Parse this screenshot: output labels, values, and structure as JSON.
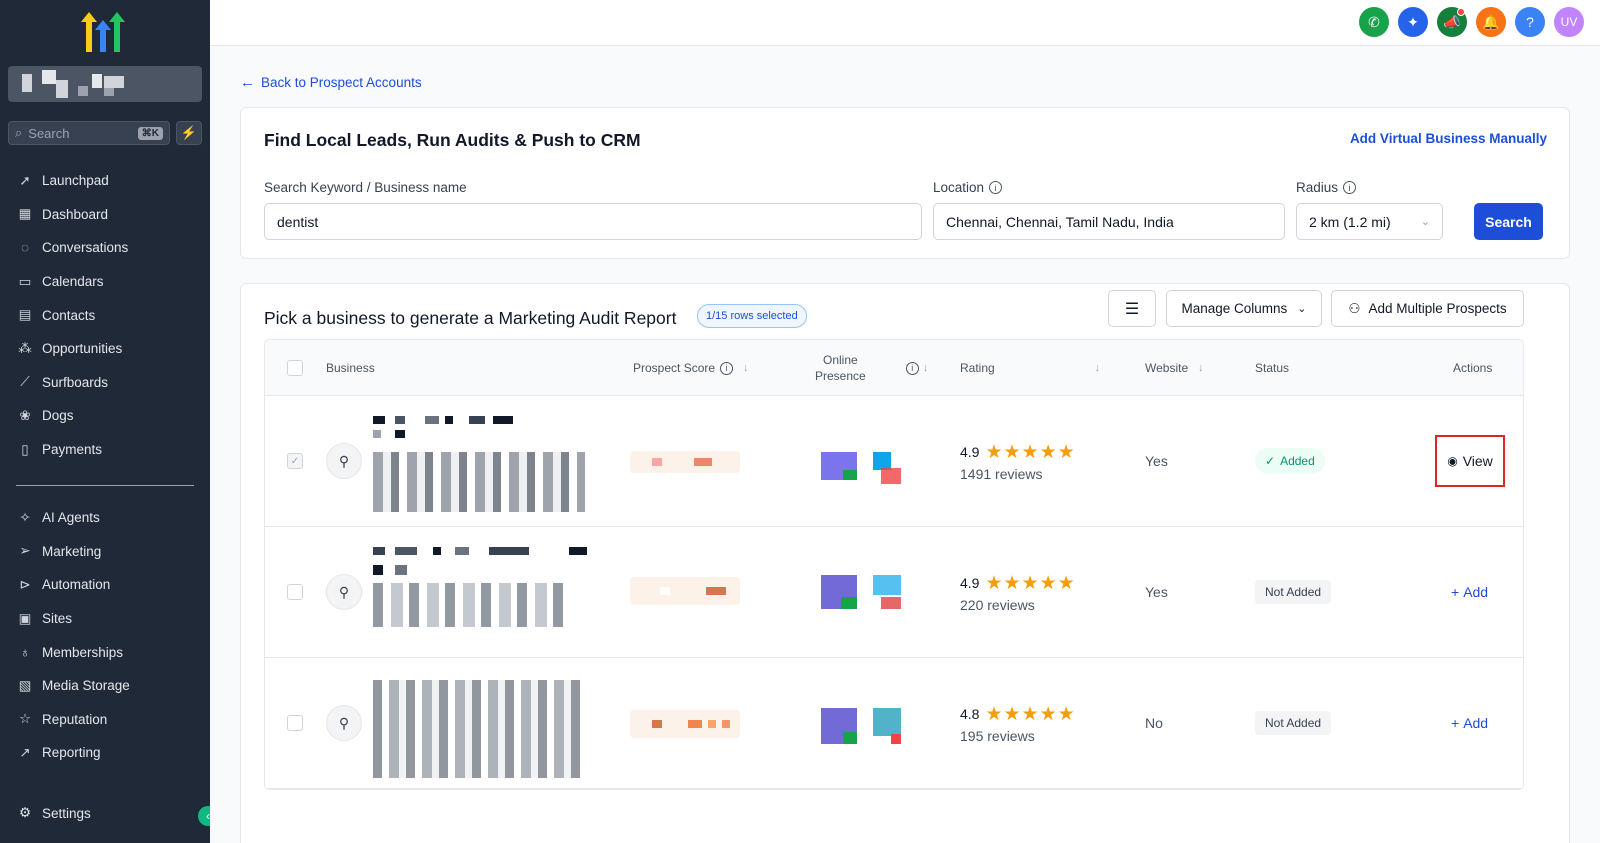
{
  "sidebar": {
    "search_placeholder": "Search",
    "search_shortcut": "⌘K",
    "items": [
      {
        "label": "Launchpad",
        "icon": "rocket-icon"
      },
      {
        "label": "Dashboard",
        "icon": "grid-icon"
      },
      {
        "label": "Conversations",
        "icon": "chat-icon"
      },
      {
        "label": "Calendars",
        "icon": "calendar-icon"
      },
      {
        "label": "Contacts",
        "icon": "contacts-icon"
      },
      {
        "label": "Opportunities",
        "icon": "network-icon"
      },
      {
        "label": "Surfboards",
        "icon": "surfboard-icon"
      },
      {
        "label": "Dogs",
        "icon": "paw-icon"
      },
      {
        "label": "Payments",
        "icon": "receipt-icon"
      }
    ],
    "items2": [
      {
        "label": "AI Agents",
        "icon": "sparkle-icon"
      },
      {
        "label": "Marketing",
        "icon": "send-icon"
      },
      {
        "label": "Automation",
        "icon": "play-circle-icon"
      },
      {
        "label": "Sites",
        "icon": "globe-icon"
      },
      {
        "label": "Memberships",
        "icon": "badge-icon"
      },
      {
        "label": "Media Storage",
        "icon": "image-icon"
      },
      {
        "label": "Reputation",
        "icon": "star-icon"
      },
      {
        "label": "Reporting",
        "icon": "trend-icon"
      }
    ],
    "settings_label": "Settings"
  },
  "topbar": {
    "icons": [
      {
        "name": "phone-icon",
        "color": "#16a34a"
      },
      {
        "name": "ai-sparkle-icon",
        "color": "#2563eb"
      },
      {
        "name": "megaphone-icon",
        "color": "#15803d"
      },
      {
        "name": "bell-icon",
        "color": "#f97316"
      },
      {
        "name": "help-icon",
        "color": "#3b82f6"
      }
    ],
    "avatar_initials": "UV",
    "avatar_color": "#c084fc"
  },
  "back_link": "Back to Prospect Accounts",
  "finder": {
    "title": "Find Local Leads, Run Audits & Push to CRM",
    "add_virtual": "Add Virtual Business Manually",
    "keyword_label": "Search Keyword / Business name",
    "keyword_value": "dentist",
    "location_label": "Location",
    "location_value": "Chennai, Chennai, Tamil Nadu, India",
    "radius_label": "Radius",
    "radius_value": "2 km (1.2 mi)",
    "search_button": "Search"
  },
  "results": {
    "title": "Pick a business to generate a Marketing Audit Report",
    "selected_badge": "1/15 rows selected",
    "manage_columns": "Manage Columns",
    "add_multiple": "Add Multiple Prospects",
    "columns": {
      "business": "Business",
      "prospect_score": "Prospect Score",
      "online_presence_1": "Online",
      "online_presence_2": "Presence",
      "rating": "Rating",
      "website": "Website",
      "status": "Status",
      "actions": "Actions"
    },
    "rows": [
      {
        "rating": "4.9",
        "reviews": "1491 reviews",
        "website": "Yes",
        "status": "Added",
        "action": "View",
        "checked": true
      },
      {
        "rating": "4.9",
        "reviews": "220 reviews",
        "website": "Yes",
        "status": "Not Added",
        "action": "Add",
        "checked": false
      },
      {
        "rating": "4.8",
        "reviews": "195 reviews",
        "website": "No",
        "status": "Not Added",
        "action": "Add",
        "checked": false
      }
    ]
  }
}
